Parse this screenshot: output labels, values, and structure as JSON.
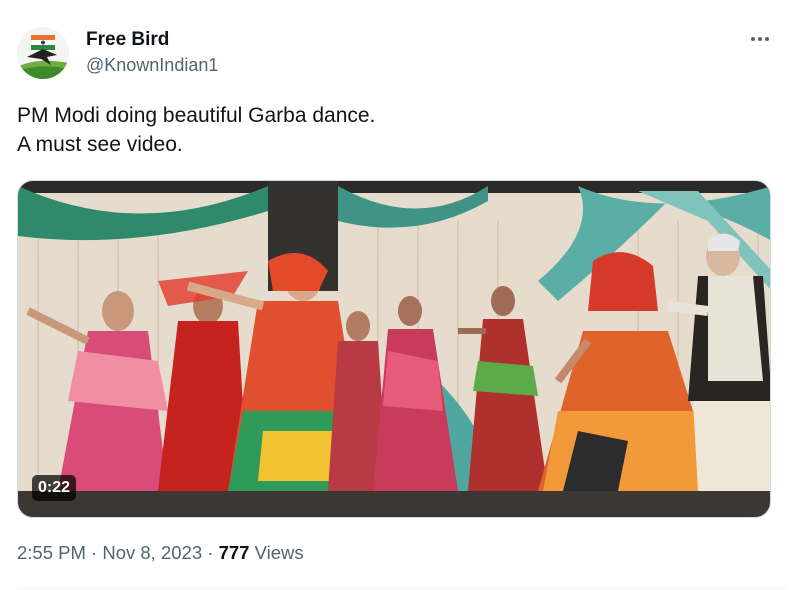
{
  "author": {
    "display_name": "Free Bird",
    "handle": "@KnownIndian1",
    "avatar_icon": "bird-avatar-icon"
  },
  "more_icon": "more-horizontal-icon",
  "tweet": {
    "text_lines": [
      "PM Modi doing beautiful Garba dance.",
      "A must see video."
    ]
  },
  "media": {
    "type": "video",
    "duration": "0:22"
  },
  "meta": {
    "time": "2:55 PM",
    "separator": "·",
    "date": "Nov 8, 2023",
    "views_count": "777",
    "views_label": "Views"
  },
  "colors": {
    "text_primary": "#0f1419",
    "text_secondary": "#536471",
    "border": "#cfd9de"
  }
}
